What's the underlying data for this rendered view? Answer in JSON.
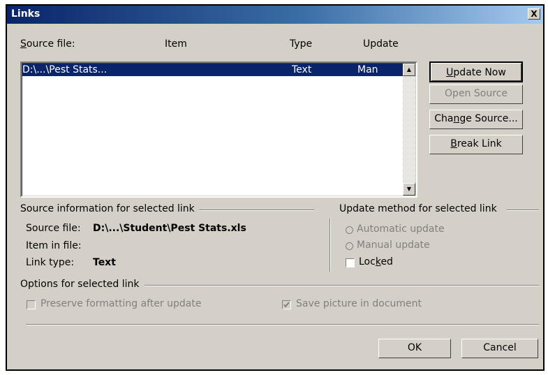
{
  "window": {
    "title": "Links",
    "close_glyph": "X"
  },
  "list": {
    "headers": {
      "source_prefix": "S",
      "source_rest": "ource file:",
      "item": "Item",
      "type": "Type",
      "update": "Update"
    },
    "rows": [
      {
        "source": "D:\\...\\Pest Stats...",
        "item": "",
        "type": "Text",
        "update": "Man"
      }
    ]
  },
  "buttons": {
    "update_now": {
      "accel": "U",
      "rest": "pdate Now"
    },
    "open_source": "Open Source",
    "change_source": {
      "pre": "Cha",
      "accel": "n",
      "rest": "ge Source..."
    },
    "break_link": {
      "accel": "B",
      "rest": "reak Link"
    },
    "ok": "OK",
    "cancel": "Cancel"
  },
  "source_info": {
    "group_label": "Source information for selected link",
    "source_file_label": "Source file:",
    "source_file_value": "D:\\...\\Student\\Pest Stats.xls",
    "item_label": "Item in file:",
    "link_type_label": "Link type:",
    "link_type_value": "Text"
  },
  "update_method": {
    "group_label": "Update method for selected link",
    "automatic": "Automatic update",
    "manual": "Manual update",
    "locked_pre": "Loc",
    "locked_accel": "k",
    "locked_rest": "ed"
  },
  "options": {
    "group_label": "Options for selected link",
    "preserve": "Preserve formatting after update",
    "save_picture": "Save picture in document",
    "save_picture_checked": true
  }
}
